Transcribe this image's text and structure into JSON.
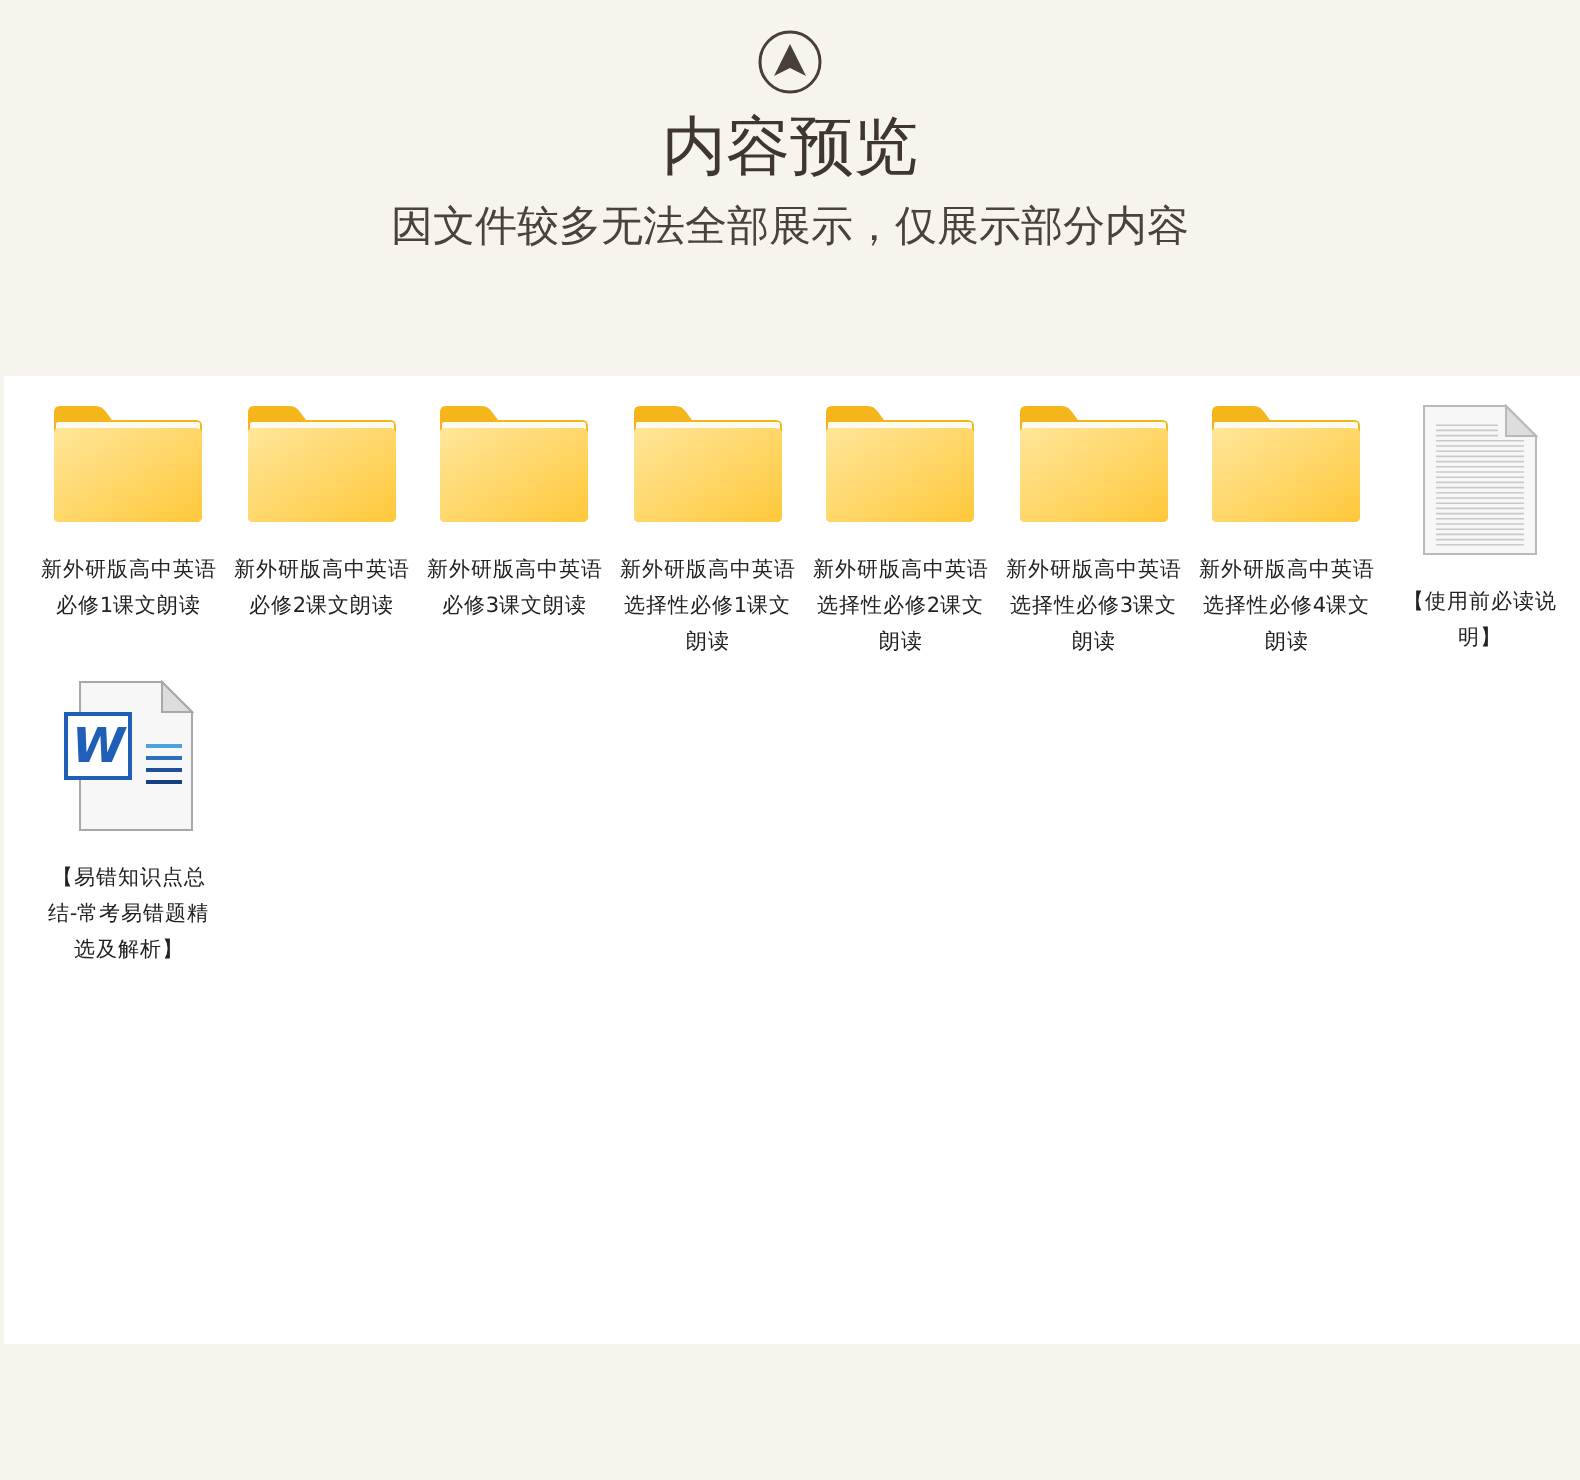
{
  "header": {
    "title": "内容预览",
    "subtitle": "因文件较多无法全部展示，仅展示部分内容"
  },
  "files": [
    {
      "kind": "folder",
      "name": "新外研版高中英语必修1课文朗读"
    },
    {
      "kind": "folder",
      "name": "新外研版高中英语必修2课文朗读"
    },
    {
      "kind": "folder",
      "name": "新外研版高中英语必修3课文朗读"
    },
    {
      "kind": "folder",
      "name": "新外研版高中英语选择性必修1课文朗读"
    },
    {
      "kind": "folder",
      "name": "新外研版高中英语选择性必修2课文朗读"
    },
    {
      "kind": "folder",
      "name": "新外研版高中英语选择性必修3课文朗读"
    },
    {
      "kind": "folder",
      "name": "新外研版高中英语选择性必修4课文朗读"
    },
    {
      "kind": "text",
      "name": "【使用前必读说明】"
    },
    {
      "kind": "word",
      "name": "【易错知识点总结-常考易错题精选及解析】",
      "glyph": "W"
    }
  ]
}
